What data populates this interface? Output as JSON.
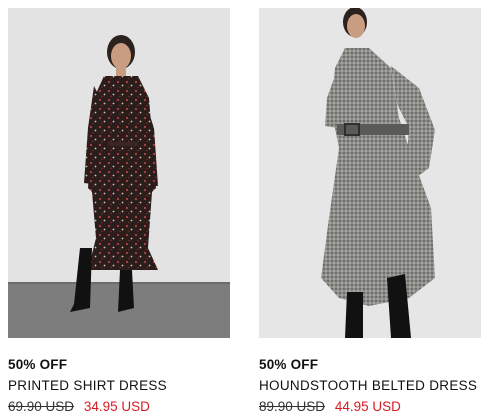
{
  "products": [
    {
      "discount": "50% OFF",
      "name": "PRINTED SHIRT DRESS",
      "old_price": "69.90 USD",
      "new_price": "34.95 USD"
    },
    {
      "discount": "50% OFF",
      "name": "HOUNDSTOOTH BELTED DRESS",
      "old_price": "89.90 USD",
      "new_price": "44.95 USD"
    }
  ],
  "colors": {
    "sale_price": "#d61a23",
    "text": "#111111",
    "photo_bg_left": "#e3e3e3",
    "floor_left": "#7d7d7d",
    "photo_bg_right": "#e6e6e6"
  }
}
